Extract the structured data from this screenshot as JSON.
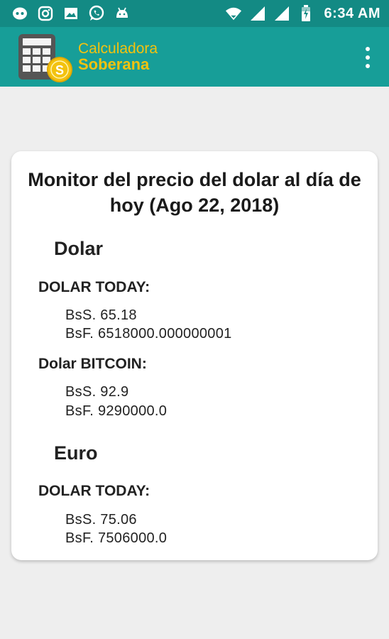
{
  "status_bar": {
    "time": "6:34 AM",
    "icons": [
      "discord-icon",
      "instagram-icon",
      "image-icon",
      "whatsapp-icon",
      "android-icon",
      "wifi-icon",
      "signal-icon",
      "signal-icon",
      "battery-charging-icon"
    ]
  },
  "app_bar": {
    "brand_line1": "Calculadora",
    "brand_line2": "Soberana",
    "overflow_icon": "more-vert-icon",
    "colors": {
      "status": "#138a84",
      "toolbar": "#179e98",
      "brand": "#f3c20f"
    }
  },
  "card": {
    "title": "Monitor del precio del dolar al día de hoy (Ago 22, 2018)",
    "sections": [
      {
        "name": "Dolar",
        "sources": [
          {
            "label": "DOLAR TODAY:",
            "bss": "BsS. 65.18",
            "bsf": "BsF. 6518000.000000001"
          },
          {
            "label": "Dolar BITCOIN:",
            "bss": "BsS. 92.9",
            "bsf": "BsF. 9290000.0"
          }
        ]
      },
      {
        "name": "Euro",
        "sources": [
          {
            "label": "DOLAR TODAY:",
            "bss": "BsS. 75.06",
            "bsf": "BsF. 7506000.0"
          }
        ]
      }
    ]
  }
}
